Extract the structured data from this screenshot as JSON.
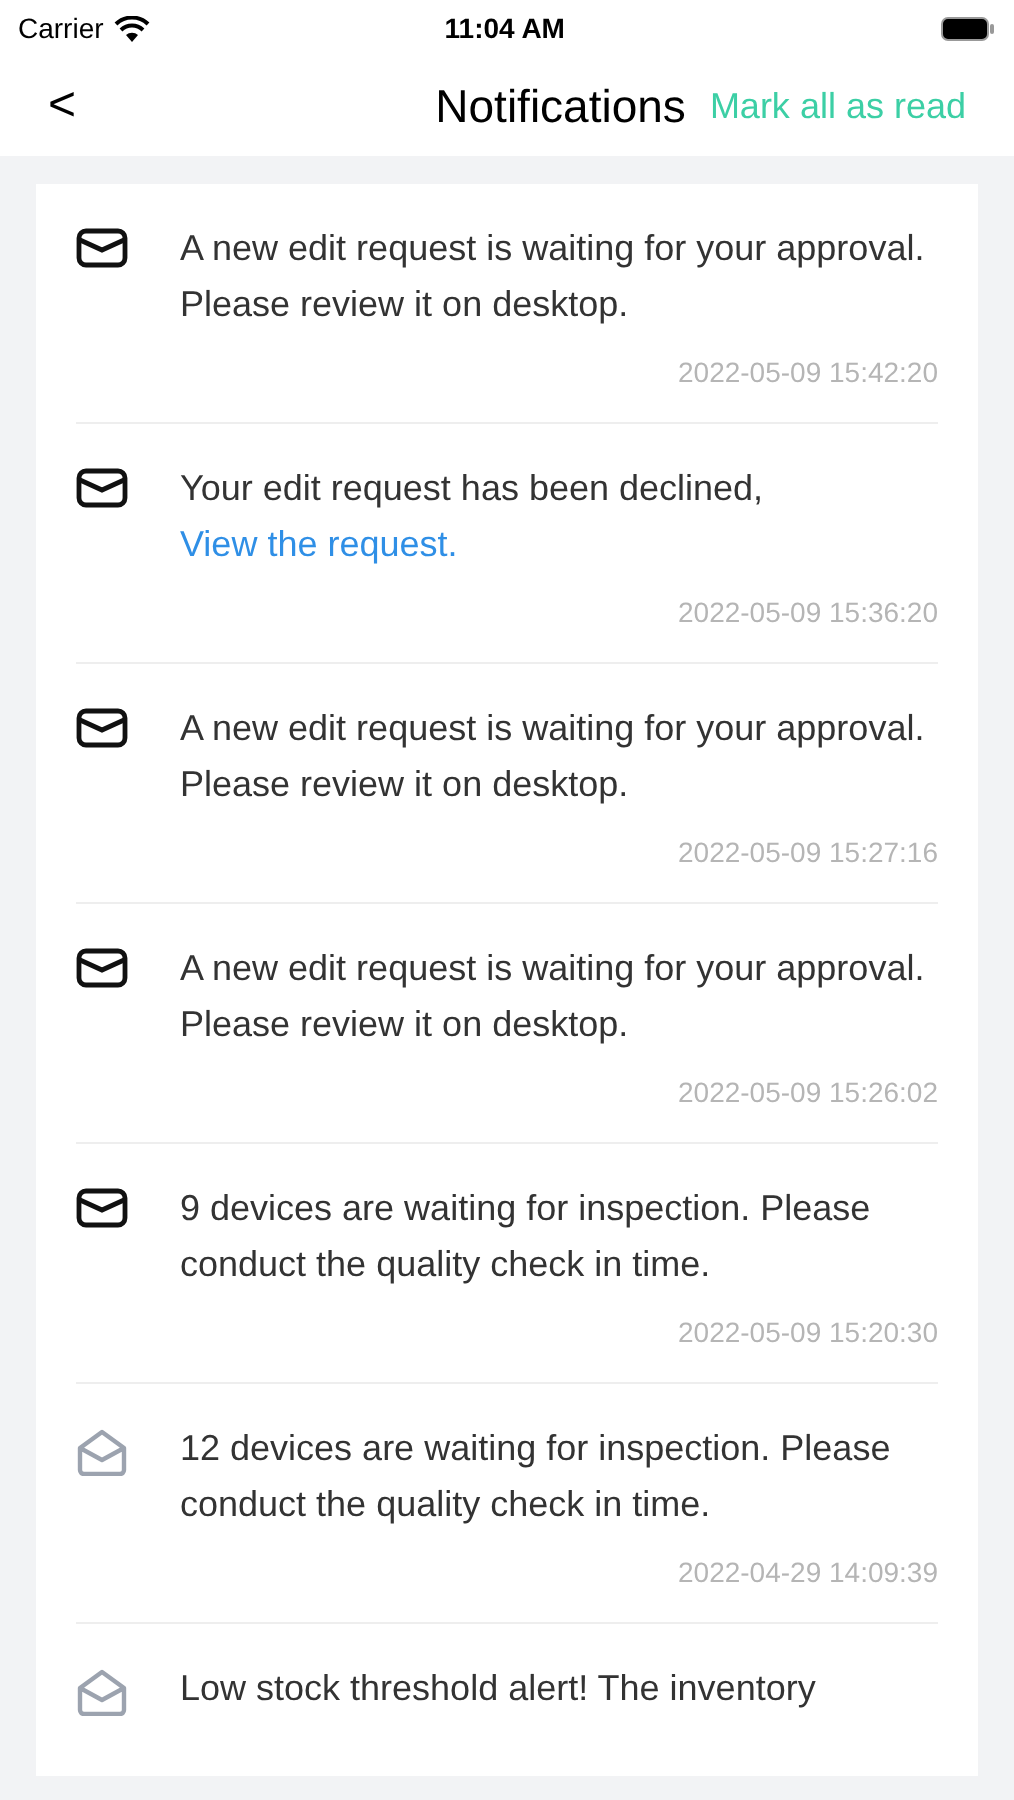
{
  "status_bar": {
    "carrier": "Carrier",
    "time": "11:04 AM"
  },
  "nav": {
    "back": "<",
    "title": "Notifications",
    "action": "Mark all as read"
  },
  "notifications": [
    {
      "text": "A new edit request is waiting for your approval. Please review it on desktop.",
      "time": "2022-05-09 15:42:20",
      "read": false
    },
    {
      "text": "Your edit request has been declined,",
      "link": "View the request.",
      "time": "2022-05-09 15:36:20",
      "read": false
    },
    {
      "text": "A new edit request is waiting for your approval. Please review it on desktop.",
      "time": "2022-05-09 15:27:16",
      "read": false
    },
    {
      "text": "A new edit request is waiting for your approval. Please review it on desktop.",
      "time": "2022-05-09 15:26:02",
      "read": false
    },
    {
      "text": "9 devices are waiting for inspection. Please conduct the quality check in time.",
      "time": "2022-05-09 15:20:30",
      "read": false
    },
    {
      "text": "12 devices are waiting for inspection. Please conduct the quality check in time.",
      "time": "2022-04-29 14:09:39",
      "read": true
    },
    {
      "text": "Low stock threshold alert! The inventory",
      "read": true
    }
  ]
}
